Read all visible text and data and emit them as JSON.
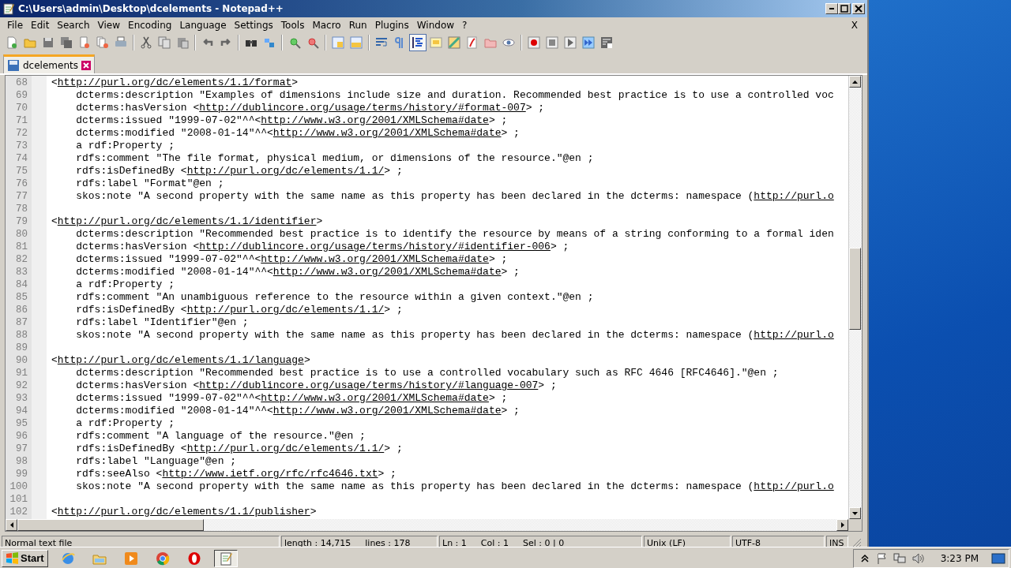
{
  "window": {
    "title": "C:\\Users\\admin\\Desktop\\dcelements - Notepad++",
    "close_document": "X"
  },
  "menu": [
    "File",
    "Edit",
    "Search",
    "View",
    "Encoding",
    "Language",
    "Settings",
    "Tools",
    "Macro",
    "Run",
    "Plugins",
    "Window",
    "?"
  ],
  "toolbar": [
    [
      {
        "kind": "new",
        "pressed": false
      },
      {
        "kind": "open",
        "pressed": false
      },
      {
        "kind": "save",
        "pressed": false
      },
      {
        "kind": "saveall",
        "pressed": false
      },
      {
        "kind": "close",
        "pressed": false
      },
      {
        "kind": "closeall",
        "pressed": false
      },
      {
        "kind": "print",
        "pressed": false
      }
    ],
    [
      {
        "kind": "cut",
        "pressed": false
      },
      {
        "kind": "copy",
        "pressed": false
      },
      {
        "kind": "paste",
        "pressed": false
      }
    ],
    [
      {
        "kind": "undo",
        "pressed": false
      },
      {
        "kind": "redo",
        "pressed": false
      }
    ],
    [
      {
        "kind": "find",
        "pressed": false
      },
      {
        "kind": "replace",
        "pressed": false
      }
    ],
    [
      {
        "kind": "zoomin",
        "pressed": false
      },
      {
        "kind": "zoomout",
        "pressed": false
      }
    ],
    [
      {
        "kind": "syncv",
        "pressed": false
      },
      {
        "kind": "synch",
        "pressed": false
      }
    ],
    [
      {
        "kind": "wrap",
        "pressed": false
      },
      {
        "kind": "allchars",
        "pressed": false
      },
      {
        "kind": "indent",
        "pressed": true
      },
      {
        "kind": "udl",
        "pressed": false
      },
      {
        "kind": "map",
        "pressed": false
      },
      {
        "kind": "func",
        "pressed": false
      },
      {
        "kind": "folder",
        "pressed": false
      },
      {
        "kind": "monitor",
        "pressed": false
      }
    ],
    [
      {
        "kind": "record",
        "pressed": false
      },
      {
        "kind": "stop",
        "pressed": false
      },
      {
        "kind": "play",
        "pressed": false
      },
      {
        "kind": "playmulti",
        "pressed": false
      },
      {
        "kind": "savemacro",
        "pressed": false
      }
    ]
  ],
  "tabs": [
    {
      "label": "dcelements",
      "selected": true
    }
  ],
  "editor": {
    "lines": [
      {
        "number": "68",
        "parts": [
          {
            "text": "<"
          },
          {
            "text": "http://purl.org/dc/elements/1.1/format",
            "kind": "link"
          },
          {
            "text": ">"
          }
        ]
      },
      {
        "number": "69",
        "parts": [
          {
            "text": "    dcterms:description \"Examples of dimensions include size and duration. Recommended best practice is to use a controlled voc"
          }
        ]
      },
      {
        "number": "70",
        "parts": [
          {
            "text": "    dcterms:hasVersion <"
          },
          {
            "text": "http://dublincore.org/usage/terms/history/#format-007",
            "kind": "link"
          },
          {
            "text": "> ;"
          }
        ]
      },
      {
        "number": "71",
        "parts": [
          {
            "text": "    dcterms:issued \"1999-07-02\"^^<"
          },
          {
            "text": "http://www.w3.org/2001/XMLSchema#date",
            "kind": "link"
          },
          {
            "text": "> ;"
          }
        ]
      },
      {
        "number": "72",
        "parts": [
          {
            "text": "    dcterms:modified \"2008-01-14\"^^<"
          },
          {
            "text": "http://www.w3.org/2001/XMLSchema#date",
            "kind": "link"
          },
          {
            "text": "> ;"
          }
        ]
      },
      {
        "number": "73",
        "parts": [
          {
            "text": "    a rdf:Property ;"
          }
        ]
      },
      {
        "number": "74",
        "parts": [
          {
            "text": "    rdfs:comment \"The file format, physical medium, or dimensions of the resource.\"@en ;"
          }
        ]
      },
      {
        "number": "75",
        "parts": [
          {
            "text": "    rdfs:isDefinedBy <"
          },
          {
            "text": "http://purl.org/dc/elements/1.1/",
            "kind": "link"
          },
          {
            "text": "> ;"
          }
        ]
      },
      {
        "number": "76",
        "parts": [
          {
            "text": "    rdfs:label \"Format\"@en ;"
          }
        ]
      },
      {
        "number": "77",
        "parts": [
          {
            "text": "    skos:note \"A second property with the same name as this property has been declared in the dcterms: namespace ("
          },
          {
            "text": "http://purl.o",
            "kind": "link"
          }
        ]
      },
      {
        "number": "78"
      },
      {
        "number": "79",
        "parts": [
          {
            "text": "<"
          },
          {
            "text": "http://purl.org/dc/elements/1.1/identifier",
            "kind": "link"
          },
          {
            "text": ">"
          }
        ]
      },
      {
        "number": "80",
        "parts": [
          {
            "text": "    dcterms:description \"Recommended best practice is to identify the resource by means of a string conforming to a formal iden"
          }
        ]
      },
      {
        "number": "81",
        "parts": [
          {
            "text": "    dcterms:hasVersion <"
          },
          {
            "text": "http://dublincore.org/usage/terms/history/#identifier-006",
            "kind": "link"
          },
          {
            "text": "> ;"
          }
        ]
      },
      {
        "number": "82",
        "parts": [
          {
            "text": "    dcterms:issued \"1999-07-02\"^^<"
          },
          {
            "text": "http://www.w3.org/2001/XMLSchema#date",
            "kind": "link"
          },
          {
            "text": "> ;"
          }
        ]
      },
      {
        "number": "83",
        "parts": [
          {
            "text": "    dcterms:modified \"2008-01-14\"^^<"
          },
          {
            "text": "http://www.w3.org/2001/XMLSchema#date",
            "kind": "link"
          },
          {
            "text": "> ;"
          }
        ]
      },
      {
        "number": "84",
        "parts": [
          {
            "text": "    a rdf:Property ;"
          }
        ]
      },
      {
        "number": "85",
        "parts": [
          {
            "text": "    rdfs:comment \"An unambiguous reference to the resource within a given context.\"@en ;"
          }
        ]
      },
      {
        "number": "86",
        "parts": [
          {
            "text": "    rdfs:isDefinedBy <"
          },
          {
            "text": "http://purl.org/dc/elements/1.1/",
            "kind": "link"
          },
          {
            "text": "> ;"
          }
        ]
      },
      {
        "number": "87",
        "parts": [
          {
            "text": "    rdfs:label \"Identifier\"@en ;"
          }
        ]
      },
      {
        "number": "88",
        "parts": [
          {
            "text": "    skos:note \"A second property with the same name as this property has been declared in the dcterms: namespace ("
          },
          {
            "text": "http://purl.o",
            "kind": "link"
          }
        ]
      },
      {
        "number": "89"
      },
      {
        "number": "90",
        "parts": [
          {
            "text": "<"
          },
          {
            "text": "http://purl.org/dc/elements/1.1/language",
            "kind": "link"
          },
          {
            "text": ">"
          }
        ]
      },
      {
        "number": "91",
        "parts": [
          {
            "text": "    dcterms:description \"Recommended best practice is to use a controlled vocabulary such as RFC 4646 [RFC4646].\"@en ;"
          }
        ]
      },
      {
        "number": "92",
        "parts": [
          {
            "text": "    dcterms:hasVersion <"
          },
          {
            "text": "http://dublincore.org/usage/terms/history/#language-007",
            "kind": "link"
          },
          {
            "text": "> ;"
          }
        ]
      },
      {
        "number": "93",
        "parts": [
          {
            "text": "    dcterms:issued \"1999-07-02\"^^<"
          },
          {
            "text": "http://www.w3.org/2001/XMLSchema#date",
            "kind": "link"
          },
          {
            "text": "> ;"
          }
        ]
      },
      {
        "number": "94",
        "parts": [
          {
            "text": "    dcterms:modified \"2008-01-14\"^^<"
          },
          {
            "text": "http://www.w3.org/2001/XMLSchema#date",
            "kind": "link"
          },
          {
            "text": "> ;"
          }
        ]
      },
      {
        "number": "95",
        "parts": [
          {
            "text": "    a rdf:Property ;"
          }
        ]
      },
      {
        "number": "96",
        "parts": [
          {
            "text": "    rdfs:comment \"A language of the resource.\"@en ;"
          }
        ]
      },
      {
        "number": "97",
        "parts": [
          {
            "text": "    rdfs:isDefinedBy <"
          },
          {
            "text": "http://purl.org/dc/elements/1.1/",
            "kind": "link"
          },
          {
            "text": "> ;"
          }
        ]
      },
      {
        "number": "98",
        "parts": [
          {
            "text": "    rdfs:label \"Language\"@en ;"
          }
        ]
      },
      {
        "number": "99",
        "parts": [
          {
            "text": "    rdfs:seeAlso <"
          },
          {
            "text": "http://www.ietf.org/rfc/rfc4646.txt",
            "kind": "link"
          },
          {
            "text": "> ;"
          }
        ]
      },
      {
        "number": "100",
        "parts": [
          {
            "text": "    skos:note \"A second property with the same name as this property has been declared in the dcterms: namespace ("
          },
          {
            "text": "http://purl.o",
            "kind": "link"
          }
        ]
      },
      {
        "number": "101"
      },
      {
        "number": "102",
        "parts": [
          {
            "text": "<"
          },
          {
            "text": "http://purl.org/dc/elements/1.1/publisher",
            "kind": "link"
          },
          {
            "text": ">"
          }
        ]
      }
    ]
  },
  "status_bar": {
    "file_type": "Normal text file",
    "length": "length : 14,715",
    "lines": "lines : 178",
    "ln": "Ln : 1",
    "col": "Col : 1",
    "sel": "Sel : 0 | 0",
    "eol": "Unix (LF)",
    "encoding": "UTF-8",
    "mode": "INS"
  },
  "taskbar": {
    "start": "Start",
    "apps": [
      {
        "kind": "browser",
        "active": false
      },
      {
        "kind": "explorer",
        "active": false
      },
      {
        "kind": "media",
        "active": false
      },
      {
        "kind": "chrome",
        "active": false
      },
      {
        "kind": "opera",
        "active": false
      },
      {
        "kind": "notepad",
        "active": true
      }
    ],
    "clock": "3:23 PM"
  }
}
